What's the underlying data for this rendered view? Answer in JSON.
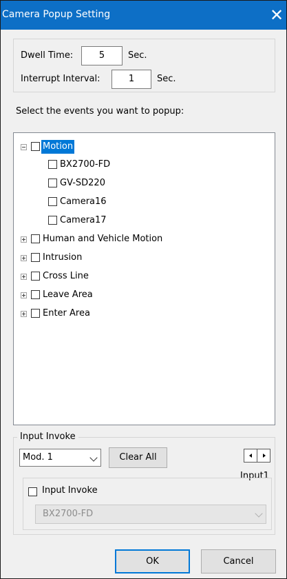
{
  "window": {
    "title": "Camera Popup Setting",
    "close_glyph": "✕"
  },
  "timing": {
    "dwell_label": "Dwell Time:",
    "dwell_value": "5",
    "dwell_unit": "Sec.",
    "interrupt_label": "Interrupt Interval:",
    "interrupt_value": "1",
    "interrupt_unit": "Sec."
  },
  "events": {
    "prompt": "Select the events you want to popup:",
    "tree": [
      {
        "label": "Motion",
        "expanded": true,
        "checked": false,
        "selected": true,
        "children": [
          {
            "label": "BX2700-FD",
            "checked": false
          },
          {
            "label": "GV-SD220",
            "checked": false
          },
          {
            "label": "Camera16",
            "checked": false
          },
          {
            "label": "Camera17",
            "checked": false
          }
        ]
      },
      {
        "label": "Human and Vehicle Motion",
        "expanded": false,
        "checked": false
      },
      {
        "label": "Intrusion",
        "expanded": false,
        "checked": false
      },
      {
        "label": "Cross Line",
        "expanded": false,
        "checked": false
      },
      {
        "label": "Leave Area",
        "expanded": false,
        "checked": false
      },
      {
        "label": "Enter Area",
        "expanded": false,
        "checked": false
      }
    ]
  },
  "input_invoke": {
    "group_title": "Input Invoke",
    "module_value": "Mod. 1",
    "clear_all_label": "Clear All",
    "input_name": "Input1",
    "checkbox_label": "Input Invoke",
    "checkbox_checked": false,
    "camera_value": "BX2700-FD",
    "camera_enabled": false
  },
  "footer": {
    "ok_label": "OK",
    "cancel_label": "Cancel"
  },
  "colors": {
    "titlebar": "#0d6fc6",
    "selection": "#0078d7",
    "dialog_bg": "#f0f0f0"
  }
}
